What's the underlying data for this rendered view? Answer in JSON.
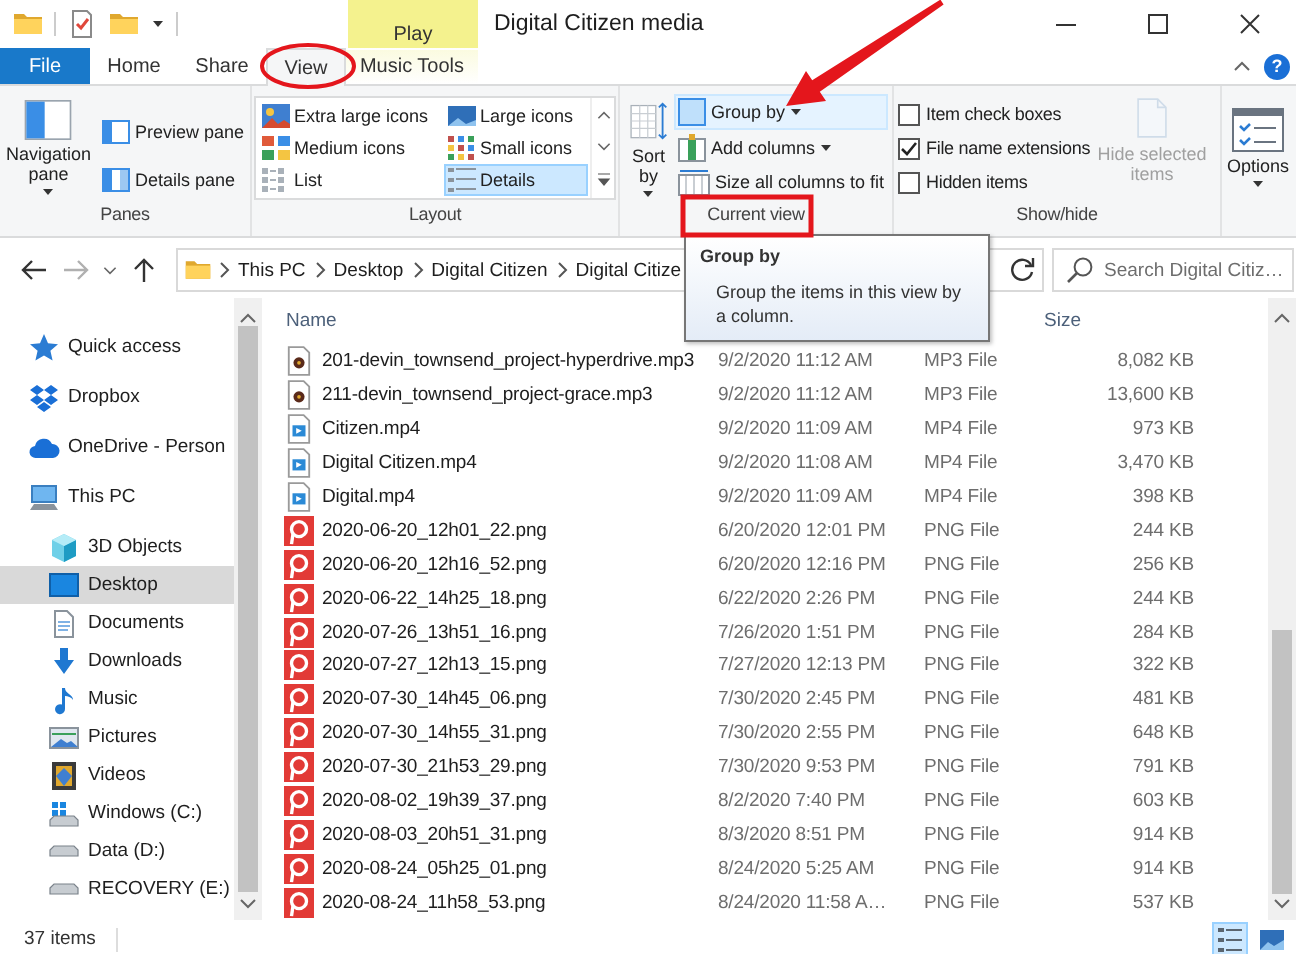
{
  "title_bar": {
    "title": "Digital Citizen media",
    "contextual_tab": "Play",
    "help": "?"
  },
  "tabs": [
    {
      "label": "File",
      "kind": "file",
      "selected": false
    },
    {
      "label": "Home",
      "kind": "normal",
      "selected": false
    },
    {
      "label": "Share",
      "kind": "normal",
      "selected": false
    },
    {
      "label": "View",
      "kind": "normal",
      "selected": true
    },
    {
      "label": "Music Tools",
      "kind": "contextual",
      "selected": false
    }
  ],
  "ribbon": {
    "panes": {
      "label": "Panes",
      "navigation_pane": "Navigation pane",
      "buttons": [
        "Preview pane",
        "Details pane"
      ]
    },
    "layout": {
      "label": "Layout",
      "options": [
        {
          "label": "Extra large icons",
          "kind": "extra_large",
          "selected": false
        },
        {
          "label": "Large icons",
          "kind": "large",
          "selected": false
        },
        {
          "label": "Medium icons",
          "kind": "medium",
          "selected": false
        },
        {
          "label": "Small icons",
          "kind": "small",
          "selected": false
        },
        {
          "label": "List",
          "kind": "list",
          "selected": false
        },
        {
          "label": "Details",
          "kind": "details",
          "selected": true
        }
      ]
    },
    "current_view": {
      "label": "Current view",
      "sort_by": "Sort by",
      "commands": [
        {
          "label": "Group by",
          "kind": "group",
          "highlighted": true
        },
        {
          "label": "Add columns",
          "kind": "add",
          "highlighted": false
        },
        {
          "label": "Size all columns to fit",
          "kind": "size",
          "highlighted": false
        }
      ]
    },
    "show_hide": {
      "label": "Show/hide",
      "checkboxes": [
        {
          "label": "Item check boxes",
          "checked": false
        },
        {
          "label": "File name extensions",
          "checked": true
        },
        {
          "label": "Hidden items",
          "checked": false
        }
      ],
      "hide_selected": {
        "label": "Hide selected items",
        "disabled": true
      }
    },
    "options": {
      "label": "Options"
    }
  },
  "address_bar": {
    "path": [
      "This PC",
      "Desktop",
      "Digital Citizen",
      "Digital Citize"
    ],
    "search_placeholder": "Search Digital Citiz…"
  },
  "navigation_pane": {
    "items": [
      {
        "label": "Quick access",
        "kind": "star",
        "selected": false
      },
      {
        "label": "Dropbox",
        "kind": "dropbox",
        "selected": false
      },
      {
        "label": "OneDrive - Person",
        "kind": "cloud",
        "selected": false
      },
      {
        "label": "This PC",
        "kind": "pc",
        "selected": false,
        "children": [
          {
            "label": "3D Objects",
            "kind": "cube",
            "selected": false
          },
          {
            "label": "Desktop",
            "kind": "desktop",
            "selected": true
          },
          {
            "label": "Documents",
            "kind": "document",
            "selected": false
          },
          {
            "label": "Downloads",
            "kind": "download",
            "selected": false
          },
          {
            "label": "Music",
            "kind": "music",
            "selected": false
          },
          {
            "label": "Pictures",
            "kind": "pictures",
            "selected": false
          },
          {
            "label": "Videos",
            "kind": "videos",
            "selected": false
          },
          {
            "label": "Windows (C:)",
            "kind": "system_drive",
            "selected": false
          },
          {
            "label": "Data (D:)",
            "kind": "drive",
            "selected": false
          },
          {
            "label": "RECOVERY (E:)",
            "kind": "drive",
            "selected": false
          }
        ]
      }
    ]
  },
  "file_list": {
    "columns": [
      {
        "label": "Name",
        "kind": "name"
      },
      {
        "label": "Size",
        "kind": "size"
      }
    ],
    "files": [
      {
        "name": "201-devin_townsend_project-hyperdrive.mp3",
        "date": "9/2/2020 11:12 AM",
        "type": "MP3 File",
        "size": "8,082 KB",
        "kind": "audio"
      },
      {
        "name": "211-devin_townsend_project-grace.mp3",
        "date": "9/2/2020 11:12 AM",
        "type": "MP3 File",
        "size": "13,600 KB",
        "kind": "audio"
      },
      {
        "name": "Citizen.mp4",
        "date": "9/2/2020 11:09 AM",
        "type": "MP4 File",
        "size": "973 KB",
        "kind": "video"
      },
      {
        "name": "Digital Citizen.mp4",
        "date": "9/2/2020 11:08 AM",
        "type": "MP4 File",
        "size": "3,470 KB",
        "kind": "video"
      },
      {
        "name": "Digital.mp4",
        "date": "9/2/2020 11:09 AM",
        "type": "MP4 File",
        "size": "398 KB",
        "kind": "video"
      },
      {
        "name": "2020-06-20_12h01_22.png",
        "date": "6/20/2020 12:01 PM",
        "type": "PNG File",
        "size": "244 KB",
        "kind": "image"
      },
      {
        "name": "2020-06-20_12h16_52.png",
        "date": "6/20/2020 12:16 PM",
        "type": "PNG File",
        "size": "256 KB",
        "kind": "image"
      },
      {
        "name": "2020-06-22_14h25_18.png",
        "date": "6/22/2020 2:26 PM",
        "type": "PNG File",
        "size": "244 KB",
        "kind": "image"
      },
      {
        "name": "2020-07-26_13h51_16.png",
        "date": "7/26/2020 1:51 PM",
        "type": "PNG File",
        "size": "284 KB",
        "kind": "image"
      },
      {
        "name": "2020-07-27_12h13_15.png",
        "date": "7/27/2020 12:13 PM",
        "type": "PNG File",
        "size": "322 KB",
        "kind": "image"
      },
      {
        "name": "2020-07-30_14h45_06.png",
        "date": "7/30/2020 2:45 PM",
        "type": "PNG File",
        "size": "481 KB",
        "kind": "image"
      },
      {
        "name": "2020-07-30_14h55_31.png",
        "date": "7/30/2020 2:55 PM",
        "type": "PNG File",
        "size": "648 KB",
        "kind": "image"
      },
      {
        "name": "2020-07-30_21h53_29.png",
        "date": "7/30/2020 9:53 PM",
        "type": "PNG File",
        "size": "791 KB",
        "kind": "image"
      },
      {
        "name": "2020-08-02_19h39_37.png",
        "date": "8/2/2020 7:40 PM",
        "type": "PNG File",
        "size": "603 KB",
        "kind": "image"
      },
      {
        "name": "2020-08-03_20h51_31.png",
        "date": "8/3/2020 8:51 PM",
        "type": "PNG File",
        "size": "914 KB",
        "kind": "image"
      },
      {
        "name": "2020-08-24_05h25_01.png",
        "date": "8/24/2020 5:25 AM",
        "type": "PNG File",
        "size": "914 KB",
        "kind": "image"
      },
      {
        "name": "2020-08-24_11h58_53.png",
        "date": "8/24/2020 11:58 A…",
        "type": "PNG File",
        "size": "537 KB",
        "kind": "image"
      }
    ]
  },
  "tooltip": {
    "title": "Group by",
    "text": "Group the items in this view by a column."
  },
  "status_bar": {
    "item_count": "37 items",
    "views": [
      {
        "kind": "details",
        "selected": true
      },
      {
        "kind": "large_icons",
        "selected": false
      }
    ]
  }
}
